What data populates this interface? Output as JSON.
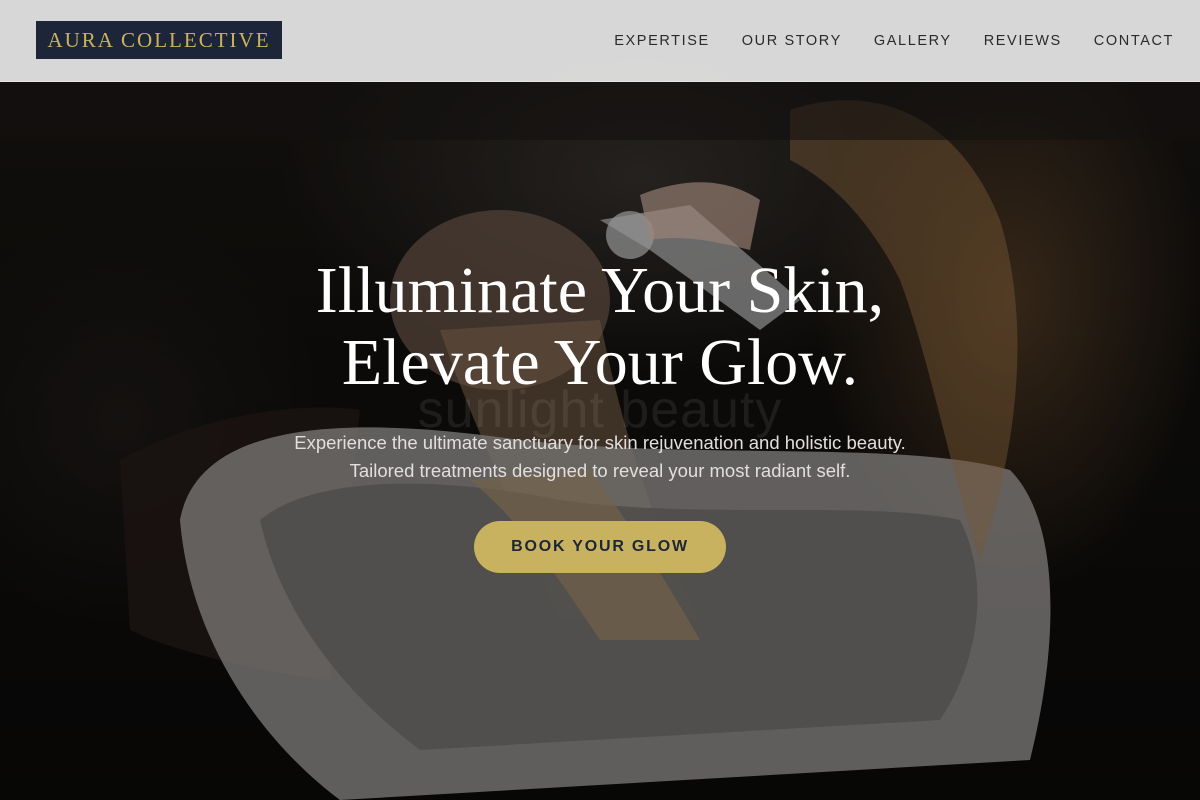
{
  "brand": {
    "logo_text": "AURA COLLECTIVE"
  },
  "nav": {
    "items": [
      {
        "label": "EXPERTISE"
      },
      {
        "label": "OUR STORY"
      },
      {
        "label": "GALLERY"
      },
      {
        "label": "REVIEWS"
      },
      {
        "label": "CONTACT"
      }
    ]
  },
  "hero": {
    "title_line1": "Illuminate Your Skin,",
    "title_line2": "Elevate Your Glow.",
    "subtitle": "Experience the ultimate sanctuary for skin rejuvenation and holistic beauty. Tailored treatments designed to reveal your most radiant self.",
    "cta_label": "BOOK YOUR GLOW",
    "watermark": "sunlight beauty"
  },
  "colors": {
    "logo_bg": "#1d2538",
    "accent_gold": "#c9b25f",
    "header_bg": "#e0e0e0",
    "hero_text": "#ffffff"
  }
}
